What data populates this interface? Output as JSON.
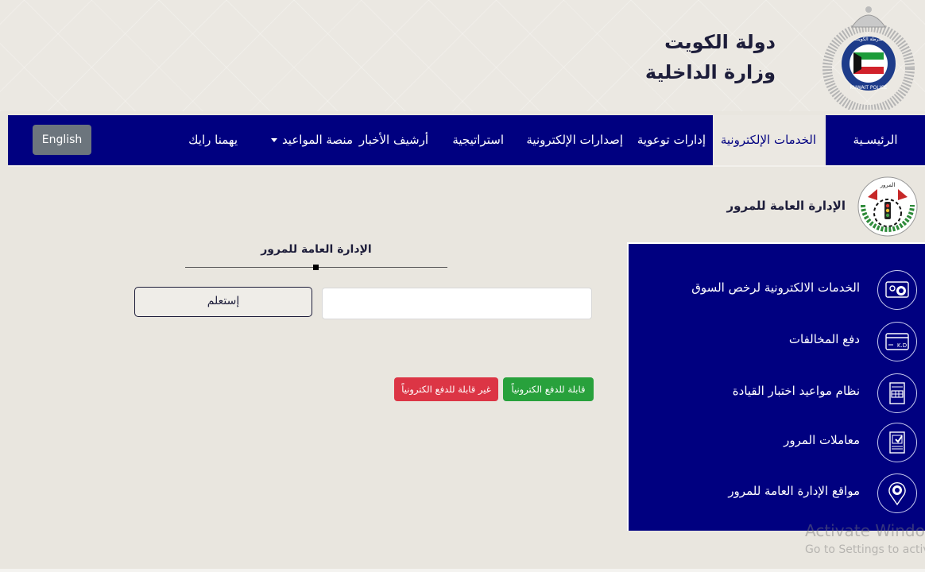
{
  "header": {
    "brand_line1": "دولة الكويت",
    "brand_line2": "وزارة الداخلية",
    "logo_icon": "kuwait-police-emblem-icon"
  },
  "nav": {
    "items": [
      {
        "label": "الرئيسـية",
        "active": false
      },
      {
        "label": "الخدمات الإلكترونية",
        "active": true
      },
      {
        "label": "إدارات توعوية",
        "active": false
      },
      {
        "label": "إصدارات الإلكترونية",
        "active": false
      },
      {
        "label": "استراتيجية",
        "active": false
      },
      {
        "label": "أرشيف الأخبار",
        "active": false
      },
      {
        "label": "منصة المواعيد",
        "active": false,
        "dropdown": true
      },
      {
        "label": "يهمنا رايك",
        "active": false
      }
    ],
    "language_button": "English",
    "bg_color": "#000080"
  },
  "department": {
    "name": "الإدارة العامة للمرور",
    "logo_icon": "traffic-department-emblem-icon"
  },
  "side_menu": {
    "items": [
      {
        "label": "الخدمات الالكترونية لرخص السوق",
        "icon": "driving-license-icon"
      },
      {
        "label": "دفع المخالفات",
        "icon": "kd-card-payment-icon"
      },
      {
        "label": "نظام مواعيد اختبار القيادة",
        "icon": "calendar-icon"
      },
      {
        "label": "معاملات المرور",
        "icon": "clipboard-check-icon"
      },
      {
        "label": "مواقع الإدارة العامة للمرور",
        "icon": "location-pin-icon"
      }
    ]
  },
  "form": {
    "title": "الإدارة العامة للمرور",
    "input_value": "",
    "input_placeholder": "",
    "query_button": "إستعلم",
    "badge_payable": "قابلة للدفع الكترونياً",
    "badge_not_payable": "غير قابلة للدفع الكترونياً",
    "colors": {
      "payable": "#28a13c",
      "not_payable": "#dc3545"
    }
  },
  "watermark": {
    "line1": "Activate Windows",
    "line2": "Go to Settings to activate Windows."
  }
}
